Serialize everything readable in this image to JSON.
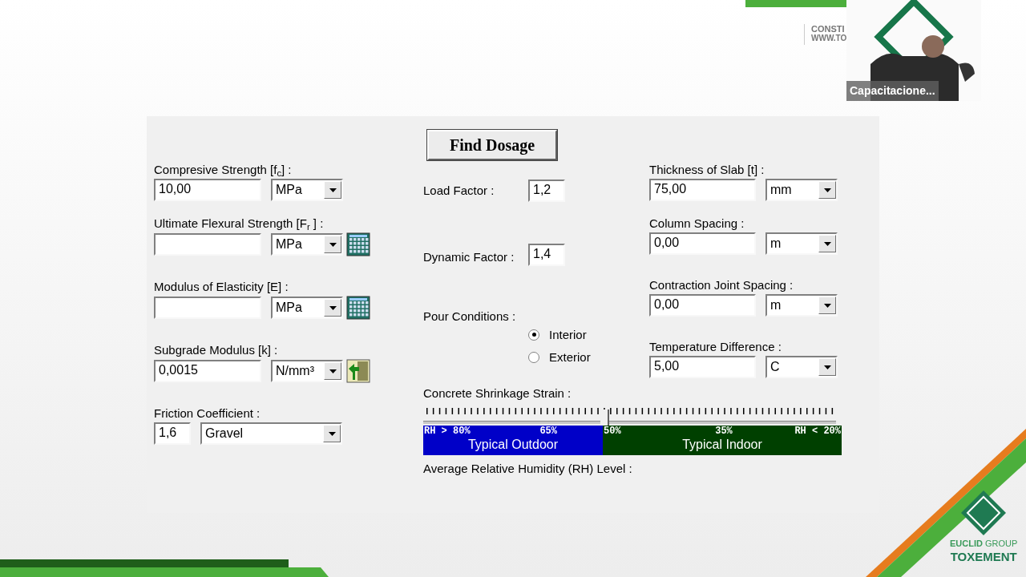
{
  "slide_header": {
    "company_text": "CONSTI",
    "url_text": "WWW.TO"
  },
  "video_tile": {
    "kind": "picture",
    "name": "Capacitacione..."
  },
  "dialog": {
    "find_button": "Find Dosage",
    "left_fields": [
      {
        "label": "Compresive Strength [f$_{c}$] :",
        "value": "10,00",
        "unit": "MPa",
        "kind": "plain"
      },
      {
        "label": "Ultimate Flexural Strength [F$_{r}$ ] :",
        "unit": "MPa",
        "kind": "calculator"
      },
      {
        "label": "Modulus of Elasticity [E] :",
        "unit": "MPa",
        "kind": "calculator"
      },
      {
        "label": "Subgrade Modulus [k] :",
        "value": "0,0015",
        "unit": "N/mm³",
        "kind": "exit"
      }
    ],
    "friction": {
      "label": "Friction Coefficient :",
      "value": "1,6",
      "material": "Gravel"
    },
    "load_factor": {
      "label": "Load Factor :",
      "value": "1,2"
    },
    "dynamic_factor": {
      "label": "Dynamic Factor :",
      "value": "1,4"
    },
    "pour_conditions": {
      "label": "Pour Conditions :",
      "options": [
        {
          "label": "Interior",
          "selected": true
        },
        {
          "label": "Exterior",
          "selected": false
        }
      ]
    },
    "right_fields": [
      {
        "label": "Thickness of Slab [t] :",
        "value": "75,00",
        "unit": "mm"
      },
      {
        "label": "Column Spacing :",
        "value": "0,00",
        "unit": "m"
      },
      {
        "label": "Contraction Joint Spacing :",
        "value": "0,00",
        "unit": "m"
      },
      {
        "label": "Temperature Difference :",
        "value": "5,00",
        "unit": "C"
      }
    ],
    "shrinkage": {
      "label": "Concrete Shrinkage Strain :",
      "level": 0.44,
      "zones": [
        {
          "label": "Typical Outdoor",
          "color": "#0000c8",
          "ticks": [
            "RH > 80%",
            "65%"
          ]
        },
        {
          "label": "Typical Indoor",
          "color": "#004000",
          "ticks": [
            "50%",
            "35%",
            "RH < 20%"
          ]
        }
      ],
      "caption": "Average Relative Humidity (RH) Level :"
    }
  },
  "footer_logo": {
    "group_bold": "EUCLID",
    "group": "GROUP",
    "brand": "TOXEMENT"
  }
}
